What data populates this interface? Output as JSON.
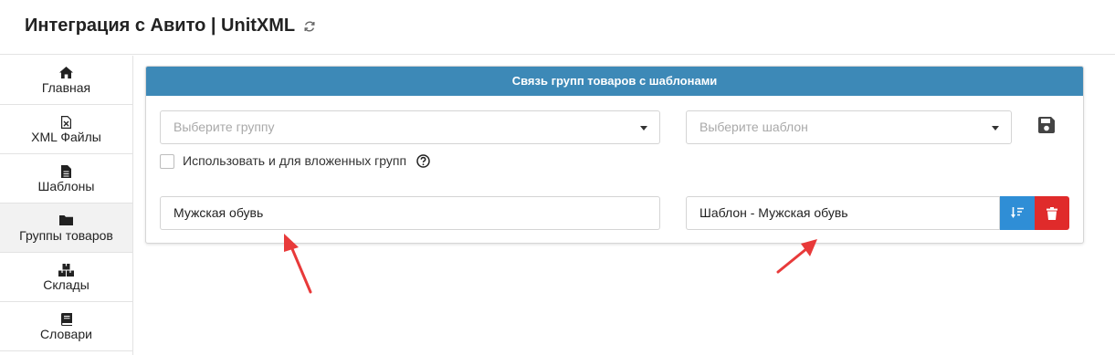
{
  "header": {
    "title": "Интеграция с Авито | UnitXML",
    "refresh_icon": "refresh-icon"
  },
  "sidebar": {
    "items": [
      {
        "label": "Главная",
        "icon": "home-icon",
        "active": false
      },
      {
        "label": "XML Файлы",
        "icon": "file-excel-icon",
        "active": false
      },
      {
        "label": "Шаблоны",
        "icon": "file-text-icon",
        "active": false
      },
      {
        "label": "Группы товаров",
        "icon": "folder-icon",
        "active": true
      },
      {
        "label": "Склады",
        "icon": "boxes-icon",
        "active": false
      },
      {
        "label": "Словари",
        "icon": "book-icon",
        "active": false
      }
    ]
  },
  "panel": {
    "title": "Связь групп товаров с шаблонами",
    "group_select": {
      "placeholder": "Выберите группу"
    },
    "template_select": {
      "placeholder": "Выберите шаблон"
    },
    "save_icon": "save-icon",
    "nested_checkbox": {
      "label": "Использовать и для вложенных групп",
      "checked": false
    },
    "mapping": {
      "group_value": "Мужская обувь",
      "template_value": "Шаблон - Мужская обувь"
    },
    "colors": {
      "header": "#3d89b7",
      "sort_button": "#2f8ed6",
      "delete_button": "#e02b2b",
      "annotation_arrow": "#e83a3a"
    }
  }
}
